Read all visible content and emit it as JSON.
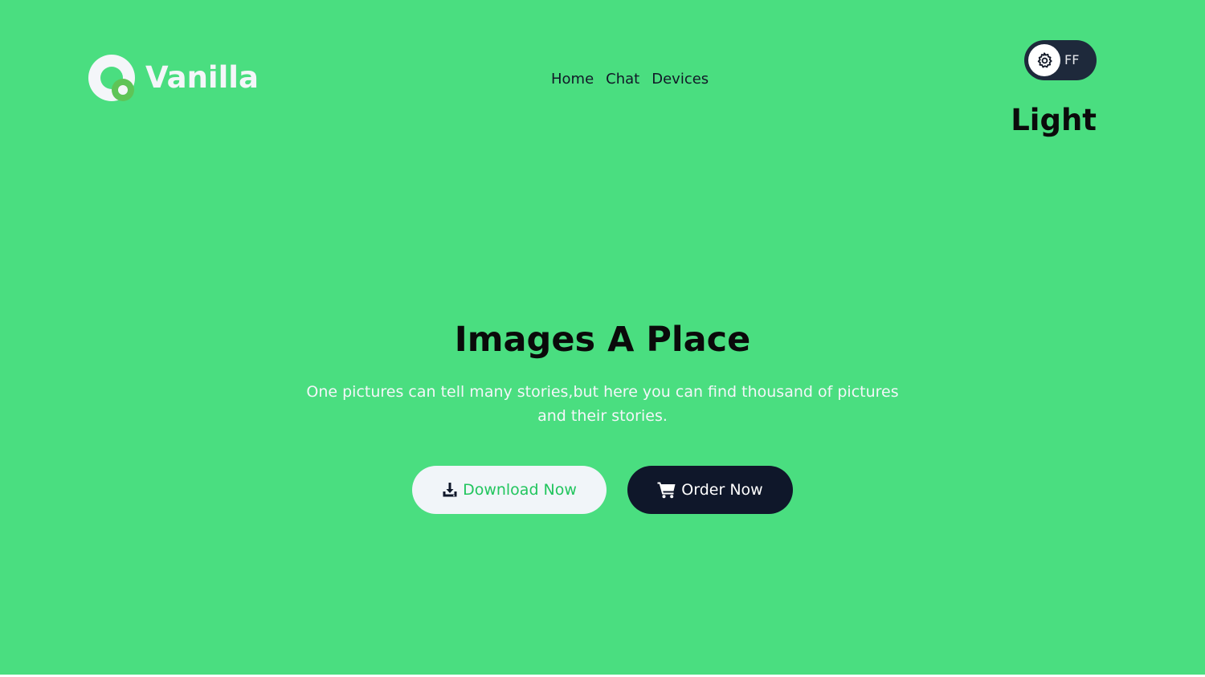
{
  "brand": {
    "name": "Vanilla",
    "logo_icon": "vanilla-logo-mark"
  },
  "nav": {
    "items": [
      {
        "label": "Home"
      },
      {
        "label": "Chat"
      },
      {
        "label": "Devices"
      }
    ]
  },
  "theme_toggle": {
    "icon": "gear-icon",
    "label": "FF",
    "mode_label": "Light"
  },
  "hero": {
    "title": "Images A Place",
    "subtitle": "One pictures can tell many stories,but here you can find thousand of pictures and their stories."
  },
  "actions": {
    "download": {
      "label": "Download Now",
      "icon": "download-icon"
    },
    "order": {
      "label": "Order Now",
      "icon": "cart-icon"
    }
  },
  "colors": {
    "background": "#4ade80",
    "dark": "#0f172a",
    "light": "#f1f5f9",
    "accent": "#22c55e"
  }
}
